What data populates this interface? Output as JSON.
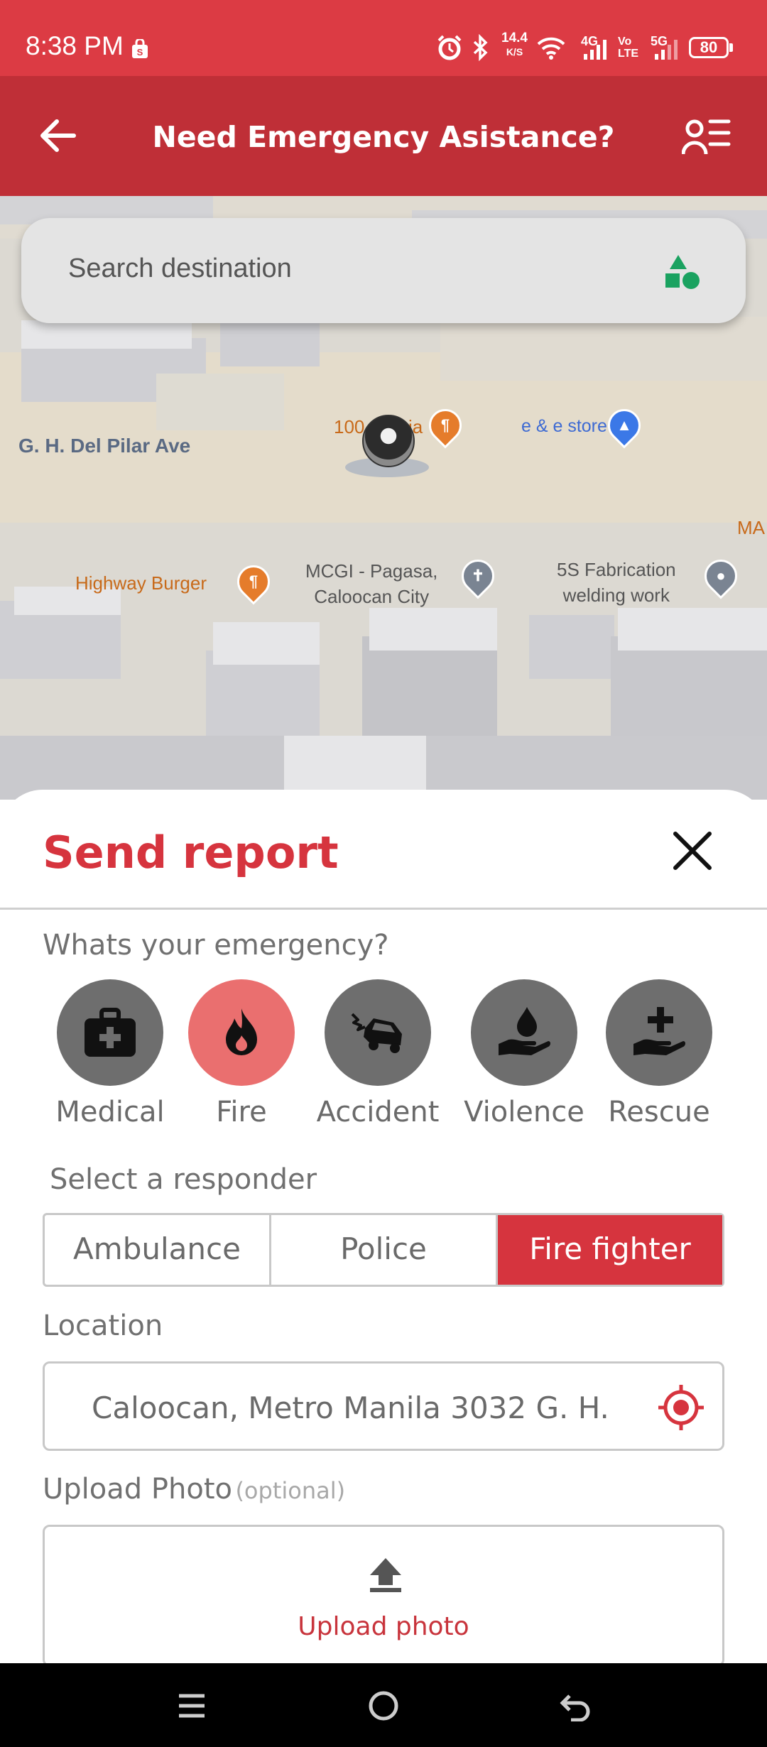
{
  "status_bar": {
    "time": "8:38 PM",
    "net_speed_value": "14.4",
    "net_speed_unit": "K/S",
    "network_4g": "4G",
    "volte": "Vo\nLTE",
    "network_5g": "5G",
    "battery": "80"
  },
  "app_bar": {
    "title": "Need Emergency Asistance?"
  },
  "map": {
    "labels": {
      "street": "G. H. Del Pilar Ave",
      "place_1": "100",
      "place_1b": "ia",
      "store": "e & e store",
      "restaurant": "Highway Burger",
      "church_line1": "MCGI - Pagasa,",
      "church_line2": "Caloocan City",
      "shop_line1": "5S Fabrication",
      "shop_line2": "welding work",
      "edge_right": "MA"
    }
  },
  "search": {
    "placeholder": "Search destination"
  },
  "sheet": {
    "title": "Send report",
    "emergency_question": "Whats your emergency?",
    "emergencies": [
      {
        "label": "Medical",
        "selected": false
      },
      {
        "label": "Fire",
        "selected": true
      },
      {
        "label": "Accident",
        "selected": false
      },
      {
        "label": "Violence",
        "selected": false
      },
      {
        "label": "Rescue",
        "selected": false
      }
    ],
    "responder_label": "Select a responder",
    "responders": [
      {
        "label": "Ambulance",
        "selected": false
      },
      {
        "label": "Police",
        "selected": false
      },
      {
        "label": "Fire fighter",
        "selected": true
      }
    ],
    "location_label": "Location",
    "location_value": "Caloocan, Metro Manila 3032 G. H.",
    "upload_label": "Upload Photo",
    "upload_optional": "(optional)",
    "upload_button": "Upload photo"
  },
  "colors": {
    "status_bar": "#dc3b44",
    "app_bar": "#bf2f37",
    "accent_red": "#d6343e",
    "selected_emergency": "#ea6f6f",
    "unselected_emergency": "#6e6e6e",
    "map_green_icon": "#1aa260"
  }
}
